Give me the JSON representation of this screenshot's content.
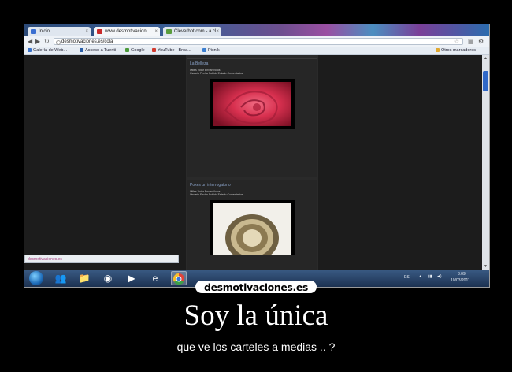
{
  "browser": {
    "tabs": [
      {
        "label": "Inicio",
        "favicon_color": "#3b6fd1",
        "active": false
      },
      {
        "label": "www.desmotivacion...",
        "favicon_color": "#c92a2a",
        "active": true
      },
      {
        "label": "Cleverbot.com - a cl...",
        "favicon_color": "#5a9d3c",
        "active": false
      }
    ],
    "url": "desmotivaciones.es/cola",
    "bookmarks": [
      {
        "label": "Galería de Web...",
        "icon_color": "#3a72c9"
      },
      {
        "label": "Acceso a Tuenti",
        "icon_color": "#2b5fa8"
      },
      {
        "label": "Google",
        "icon_color": "#4b9a3a"
      },
      {
        "label": "YouTube - Broa...",
        "icon_color": "#d23b2f"
      },
      {
        "label": "Picnik",
        "icon_color": "#3c7fd0"
      },
      {
        "label": "Otros marcadores",
        "icon_color": "#e0a830"
      }
    ],
    "status_text": "desmotivaciones.es"
  },
  "posts": [
    {
      "title": "La Belleza",
      "meta1": "Utiles  Votar  Enviar  Votos  ",
      "meta2": "Usuario  Fecha  Subido  Estado  Comentarios"
    },
    {
      "title": "Pokes un interrogatorio",
      "meta1": "Utiles  Votar  Enviar  Votos  ",
      "meta2": "Usuario  Fecha  Subido  Estado  Comentarios"
    }
  ],
  "taskbar": {
    "language": "ES",
    "time": "3:09",
    "date": "10/03/2011"
  },
  "poster": {
    "logo": "desmotivaciones.es",
    "headline": "Soy la única",
    "subline": "que ve los carteles a medias .. ?"
  }
}
